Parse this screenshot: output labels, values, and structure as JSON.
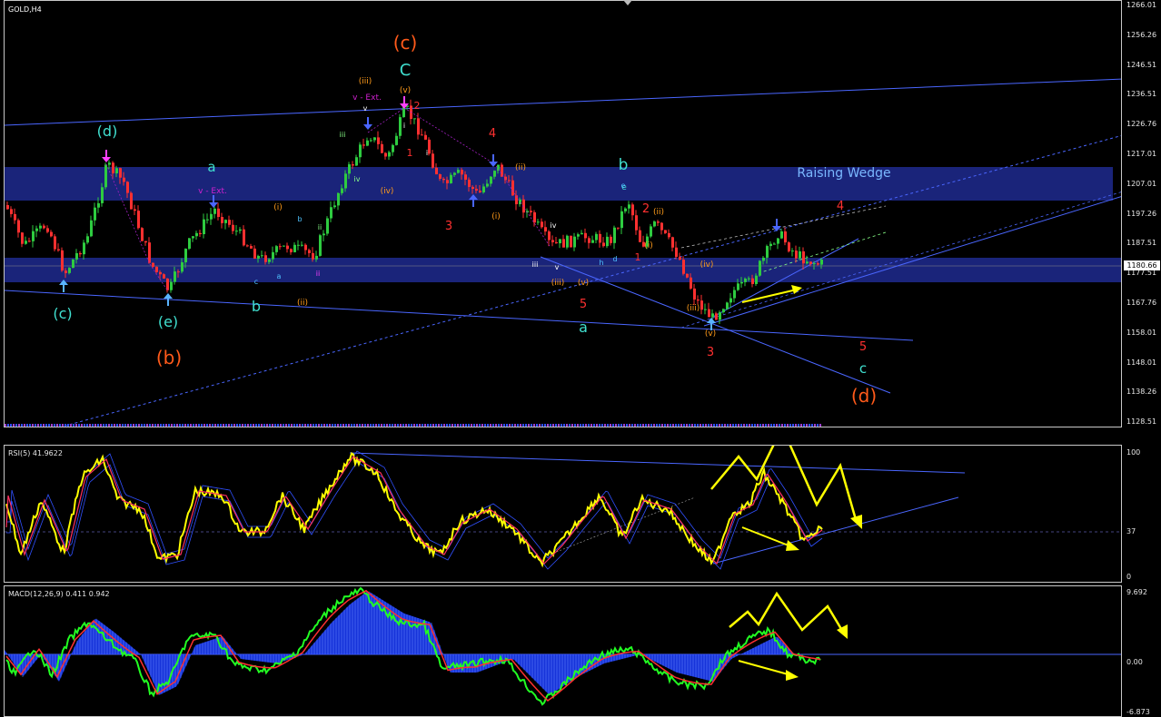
{
  "window": {
    "title": "GOLD,H4"
  },
  "colors": {
    "background": "#000000",
    "bull_candle": "#2ecc40",
    "bear_candle": "#ff3030",
    "band": "#1e2a8f",
    "trend_line": "#4a66ff",
    "annotation_arrow": "#ffff00",
    "rsi_line": "#ffff00",
    "macd_line": "#22ff22",
    "signal_line": "#ff3030",
    "histogram": "#1a3cff"
  },
  "main_chart": {
    "price_axis": [
      "1266.01",
      "1256.26",
      "1246.51",
      "1236.51",
      "1226.76",
      "1217.01",
      "1207.01",
      "1197.26",
      "1187.51",
      "1177.51",
      "1167.76",
      "1158.01",
      "1148.01",
      "1138.26",
      "1128.51"
    ],
    "current_price": "1180.66",
    "wedge_label": "Raising Wedge",
    "wave_labels": [
      {
        "text": "(c)",
        "color": "#ff5a1a"
      },
      {
        "text": "C",
        "color": "#40e0d0"
      },
      {
        "text": "(d)",
        "color": "#40e0d0"
      },
      {
        "text": "a",
        "color": "#40e0d0"
      },
      {
        "text": "v - Ext.",
        "color": "#d020d0"
      },
      {
        "text": "(iii)",
        "color": "#ff9b1a"
      },
      {
        "text": "v - Ext.",
        "color": "#d020d0"
      },
      {
        "text": "(v)",
        "color": "#ff9b1a"
      },
      {
        "text": "2",
        "color": "#ff3030"
      },
      {
        "text": "1",
        "color": "#ff3030"
      },
      {
        "text": "4",
        "color": "#ff3030"
      },
      {
        "text": "3",
        "color": "#ff3030"
      },
      {
        "text": "b",
        "color": "#40e0d0"
      },
      {
        "text": "(ii)",
        "color": "#ff9b1a"
      },
      {
        "text": "e",
        "color": "#40e0d0"
      },
      {
        "text": "2",
        "color": "#ff3030"
      },
      {
        "text": "(ii)",
        "color": "#ff9b1a"
      },
      {
        "text": "4",
        "color": "#ff3030"
      },
      {
        "text": "(iv)",
        "color": "#ff9b1a"
      },
      {
        "text": "(c)",
        "color": "#40e0d0"
      },
      {
        "text": "(e)",
        "color": "#40e0d0"
      },
      {
        "text": "(b)",
        "color": "#ff5a1a"
      },
      {
        "text": "b",
        "color": "#40e0d0"
      },
      {
        "text": "(ii)",
        "color": "#ff9b1a"
      },
      {
        "text": "5",
        "color": "#ff3030"
      },
      {
        "text": "a",
        "color": "#40e0d0"
      },
      {
        "text": "(iii)",
        "color": "#ff9b1a"
      },
      {
        "text": "(v)",
        "color": "#ff9b1a"
      },
      {
        "text": "3",
        "color": "#ff3030"
      },
      {
        "text": "5",
        "color": "#ff3030"
      },
      {
        "text": "c",
        "color": "#40e0d0"
      },
      {
        "text": "(d)",
        "color": "#ff5a1a"
      },
      {
        "text": "(i)",
        "color": "#ff9b1a"
      },
      {
        "text": "(iv)",
        "color": "#ff9b1a"
      },
      {
        "text": "(i)",
        "color": "#ff9b1a"
      },
      {
        "text": "1",
        "color": "#ff3030"
      },
      {
        "text": "(iii)",
        "color": "#ff9b1a"
      },
      {
        "text": "(v)",
        "color": "#ff9b1a"
      },
      {
        "text": "(i)",
        "color": "#ff9b1a"
      }
    ],
    "minor_labels": [
      "iii",
      "iv",
      "v",
      "ii",
      "i",
      "b",
      "c",
      "a",
      "d",
      "e",
      "h",
      "iii",
      "iv",
      "i",
      "ii",
      "v"
    ]
  },
  "rsi_panel": {
    "title": "RSI(5) 41.9622",
    "axis": [
      "100",
      "37",
      "0"
    ]
  },
  "macd_panel": {
    "title": "MACD(12,26,9) 0.411 0.942",
    "axis": [
      "9.692",
      "0.00",
      "-6.873"
    ]
  }
}
